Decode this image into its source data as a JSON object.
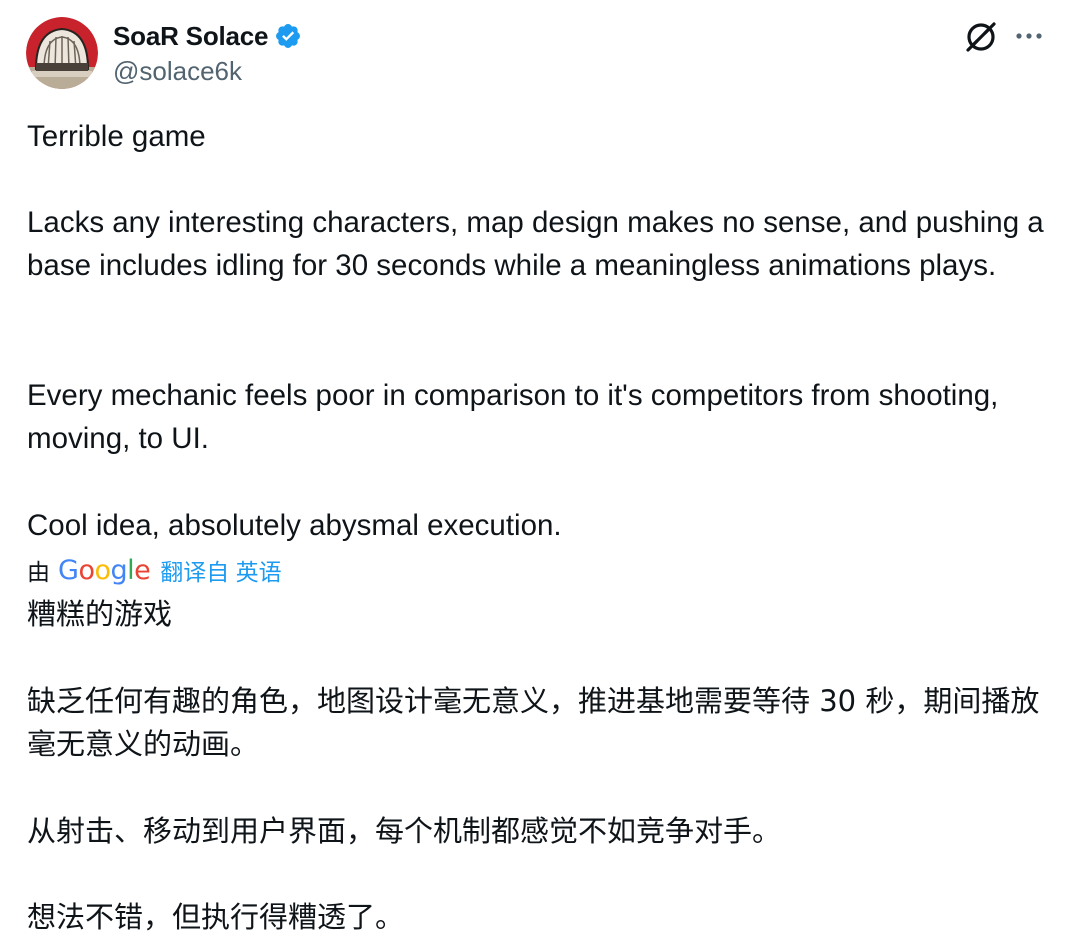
{
  "user": {
    "display_name": "SoaR Solace",
    "handle": "@solace6k",
    "verified": true,
    "avatar_icon": "avatar-helmet-image"
  },
  "actions": {
    "grok_icon": "grok-icon",
    "more_icon": "more-icon"
  },
  "tweet": {
    "paragraphs": [
      "Terrible game",
      "Lacks any interesting characters, map design makes no sense, and pushing a base includes idling for 30 seconds while a meaningless animations plays.",
      "Every mechanic feels poor in comparison to it's competitors from shooting, moving, to UI.",
      "Cool idea, absolutely abysmal execution."
    ]
  },
  "translation": {
    "prefix": "由",
    "provider": "Google",
    "link_text": "翻译自 英语",
    "paragraphs": [
      "糟糕的游戏",
      "缺乏任何有趣的角色，地图设计毫无意义，推进基地需要等待 30 秒，期间播放毫无意义的动画。",
      "从射击、移动到用户界面，每个机制都感觉不如竞争对手。",
      "想法不错，但执行得糟透了。"
    ]
  },
  "colors": {
    "text": "#0f1419",
    "secondary": "#536471",
    "accent": "#1d9bf0",
    "google_blue": "#4285f4",
    "google_red": "#ea4335",
    "google_yellow": "#fbbc05",
    "google_green": "#34a853"
  }
}
